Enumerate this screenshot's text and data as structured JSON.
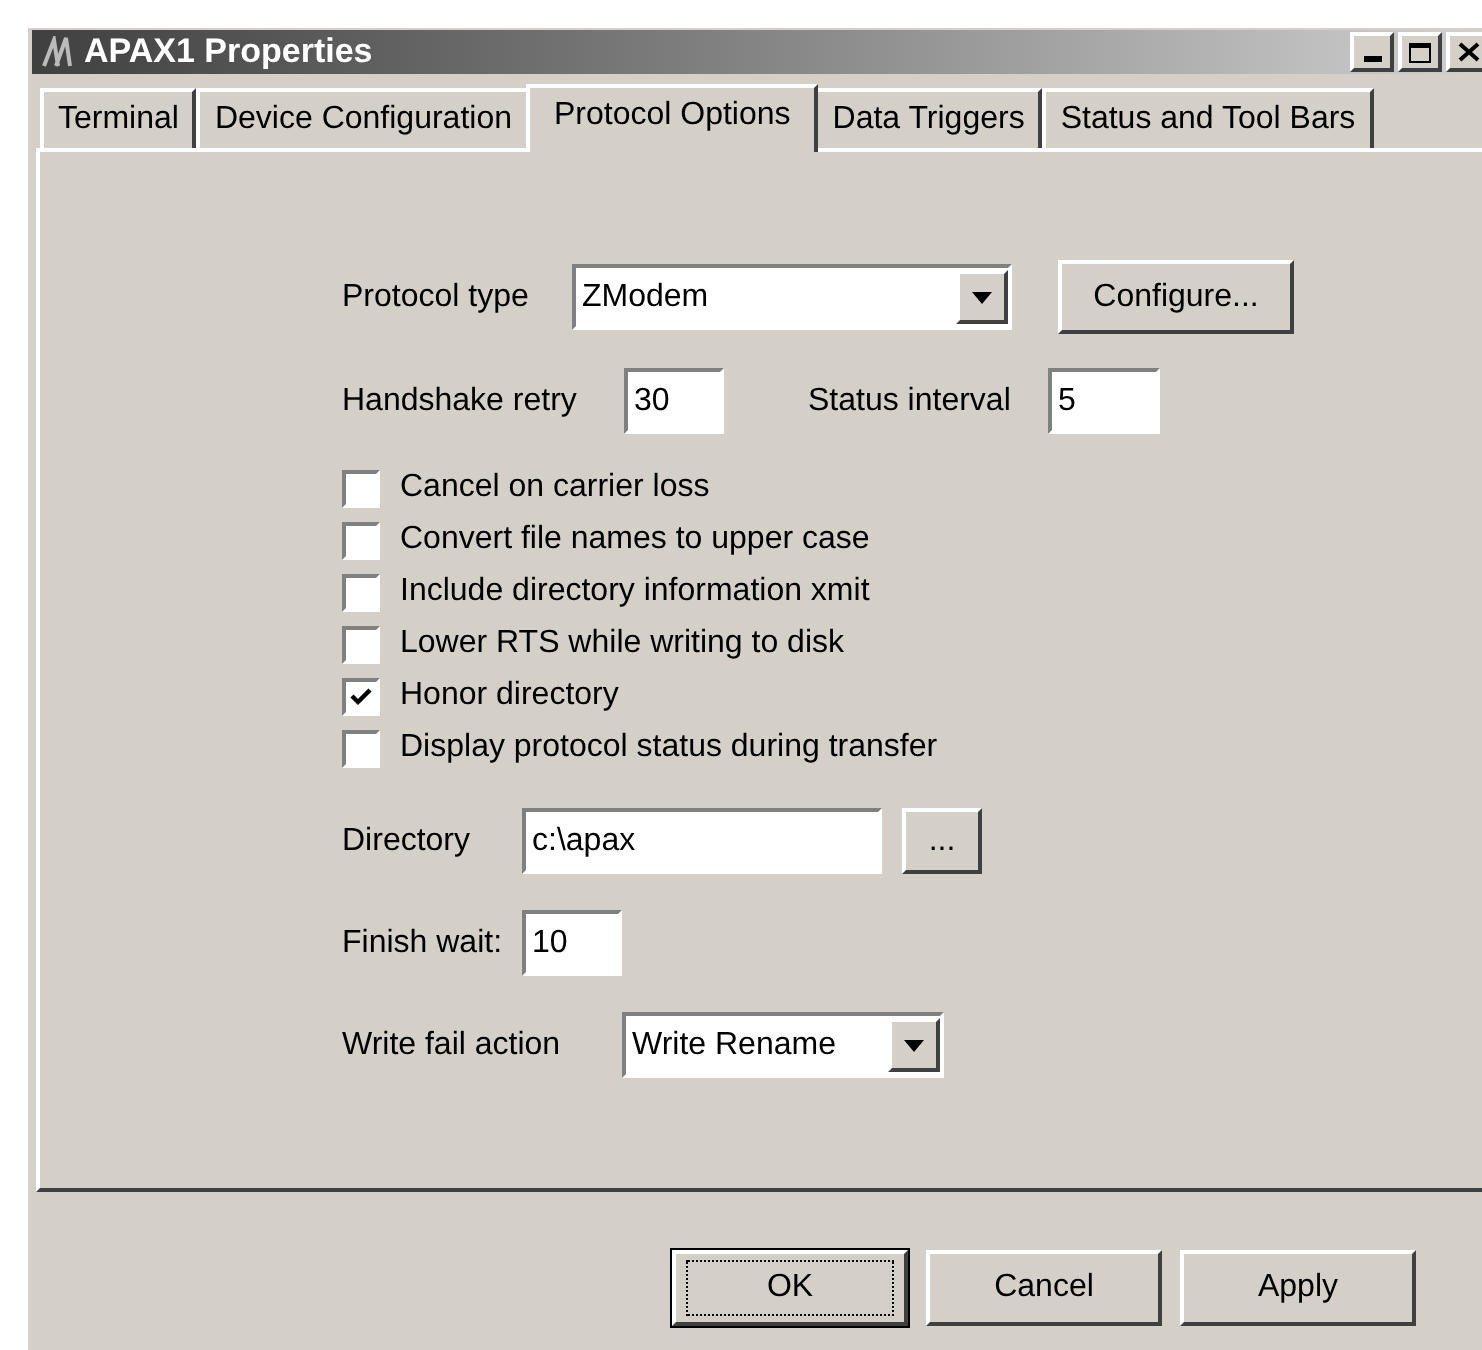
{
  "window": {
    "title": "APAX1 Properties"
  },
  "tabs": [
    {
      "label": "Terminal",
      "selected": false
    },
    {
      "label": "Device Configuration",
      "selected": false
    },
    {
      "label": "Protocol Options",
      "selected": true
    },
    {
      "label": "Data Triggers",
      "selected": false
    },
    {
      "label": "Status and Tool Bars",
      "selected": false
    }
  ],
  "protocol_type": {
    "label": "Protocol type",
    "value": "ZModem",
    "button": "Configure..."
  },
  "handshake_retry": {
    "label": "Handshake retry",
    "value": "30"
  },
  "status_interval": {
    "label": "Status interval",
    "value": "5"
  },
  "options": [
    {
      "label": "Cancel on carrier loss",
      "checked": false
    },
    {
      "label": "Convert file names to upper case",
      "checked": false
    },
    {
      "label": "Include directory information xmit",
      "checked": false
    },
    {
      "label": "Lower RTS while writing to disk",
      "checked": false
    },
    {
      "label": "Honor directory",
      "checked": true
    },
    {
      "label": "Display protocol status during transfer",
      "checked": false
    }
  ],
  "directory": {
    "label": "Directory",
    "value": "c:\\apax",
    "button": "..."
  },
  "finish_wait": {
    "label": "Finish wait:",
    "value": "10"
  },
  "write_fail_action": {
    "label": "Write fail action",
    "value": "Write Rename"
  },
  "buttons": [
    {
      "label": "OK",
      "default": true
    },
    {
      "label": "Cancel",
      "default": false
    },
    {
      "label": "Apply",
      "default": false
    }
  ]
}
